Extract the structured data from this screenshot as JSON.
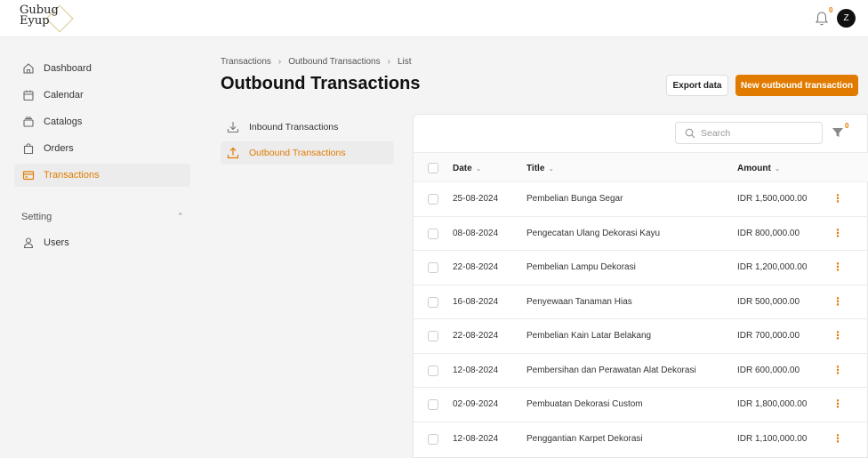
{
  "logo": {
    "line1": "Gubug",
    "line2": "Eyup"
  },
  "header": {
    "notification_count": "0",
    "avatar_initial": "Z"
  },
  "sidebar": {
    "items": [
      {
        "label": "Dashboard",
        "icon": "home-icon"
      },
      {
        "label": "Calendar",
        "icon": "calendar-icon"
      },
      {
        "label": "Catalogs",
        "icon": "catalog-icon"
      },
      {
        "label": "Orders",
        "icon": "bag-icon"
      },
      {
        "label": "Transactions",
        "icon": "card-icon",
        "active": true
      }
    ],
    "section_label": "Setting",
    "section_items": [
      {
        "label": "Users",
        "icon": "user-icon"
      }
    ]
  },
  "breadcrumb": [
    "Transactions",
    "Outbound Transactions",
    "List"
  ],
  "page_title": "Outbound Transactions",
  "actions": {
    "export_label": "Export data",
    "new_label": "New outbound transaction"
  },
  "subnav": [
    {
      "label": "Inbound Transactions",
      "icon": "download-icon"
    },
    {
      "label": "Outbound Transactions",
      "icon": "upload-icon",
      "active": true
    }
  ],
  "search": {
    "placeholder": "Search"
  },
  "filter_count": "0",
  "table": {
    "columns": [
      "Date",
      "Title",
      "Amount"
    ],
    "rows": [
      {
        "date": "25-08-2024",
        "title": "Pembelian Bunga Segar",
        "amount": "IDR 1,500,000.00"
      },
      {
        "date": "08-08-2024",
        "title": "Pengecatan Ulang Dekorasi Kayu",
        "amount": "IDR 800,000.00"
      },
      {
        "date": "22-08-2024",
        "title": "Pembelian Lampu Dekorasi",
        "amount": "IDR 1,200,000.00"
      },
      {
        "date": "16-08-2024",
        "title": "Penyewaan Tanaman Hias",
        "amount": "IDR 500,000.00"
      },
      {
        "date": "22-08-2024",
        "title": "Pembelian Kain Latar Belakang",
        "amount": "IDR 700,000.00"
      },
      {
        "date": "12-08-2024",
        "title": "Pembersihan dan Perawatan Alat Dekorasi",
        "amount": "IDR 600,000.00"
      },
      {
        "date": "02-09-2024",
        "title": "Pembuatan Dekorasi Custom",
        "amount": "IDR 1,800,000.00"
      },
      {
        "date": "12-08-2024",
        "title": "Penggantian Karpet Dekorasi",
        "amount": "IDR 1,100,000.00"
      }
    ]
  },
  "colors": {
    "accent": "#e07b00",
    "active_bg": "#ececec"
  }
}
